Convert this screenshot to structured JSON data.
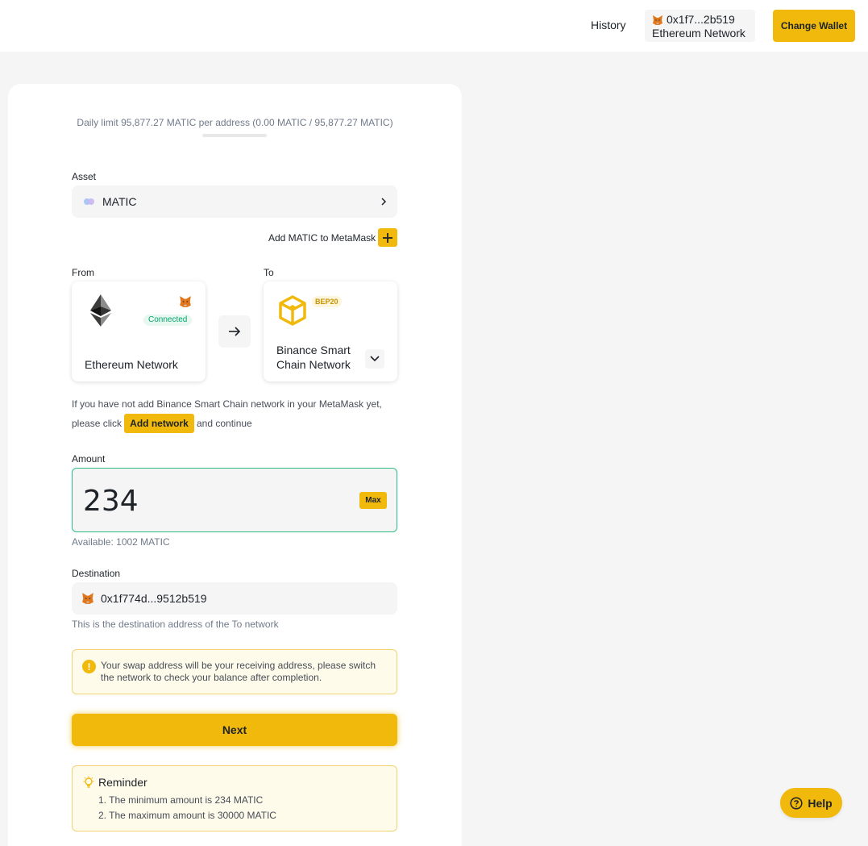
{
  "header": {
    "history_label": "History",
    "wallet": {
      "address": "0x1f7...2b519",
      "network": "Ethereum Network",
      "icon": "metamask-fox-icon"
    },
    "change_wallet_label": "Change Wallet"
  },
  "bridge": {
    "daily_limit_text": "Daily limit 95,877.27 MATIC per address (0.00 MATIC / 95,877.27 MATIC)",
    "daily_limit_used_fraction": 0,
    "asset": {
      "label": "Asset",
      "value": "MATIC",
      "icon": "matic-icon"
    },
    "add_to_metamask_label": "Add MATIC to MetaMask",
    "from": {
      "label": "From",
      "network": "Ethereum Network",
      "status": "Connected",
      "icon": "ethereum-icon"
    },
    "to": {
      "label": "To",
      "network_line1": "Binance Smart",
      "network_line2": "Chain Network",
      "badge": "BEP20",
      "icon": "bnb-icon"
    },
    "add_network_hint": {
      "line1": "If you have not add Binance Smart Chain network in your MetaMask yet,",
      "prefix": "please click",
      "button_label": "Add network",
      "suffix": "and continue"
    },
    "amount": {
      "label": "Amount",
      "value": "234",
      "max_label": "Max",
      "available": "Available: 1002 MATIC"
    },
    "destination": {
      "label": "Destination",
      "address": "0x1f774d...9512b519",
      "note": "This is the destination address of the To network"
    },
    "warning": {
      "text": "Your swap address will be your receiving address, please switch the network to check your balance after completion."
    },
    "next_label": "Next",
    "reminder": {
      "title": "Reminder",
      "items": [
        "1. The minimum amount is 234 MATIC",
        "2. The maximum amount is 30000 MATIC"
      ]
    }
  },
  "help_label": "Help",
  "colors": {
    "accent": "#f0b90b",
    "success": "#03a66d",
    "page_bg": "#f5f5f5"
  }
}
